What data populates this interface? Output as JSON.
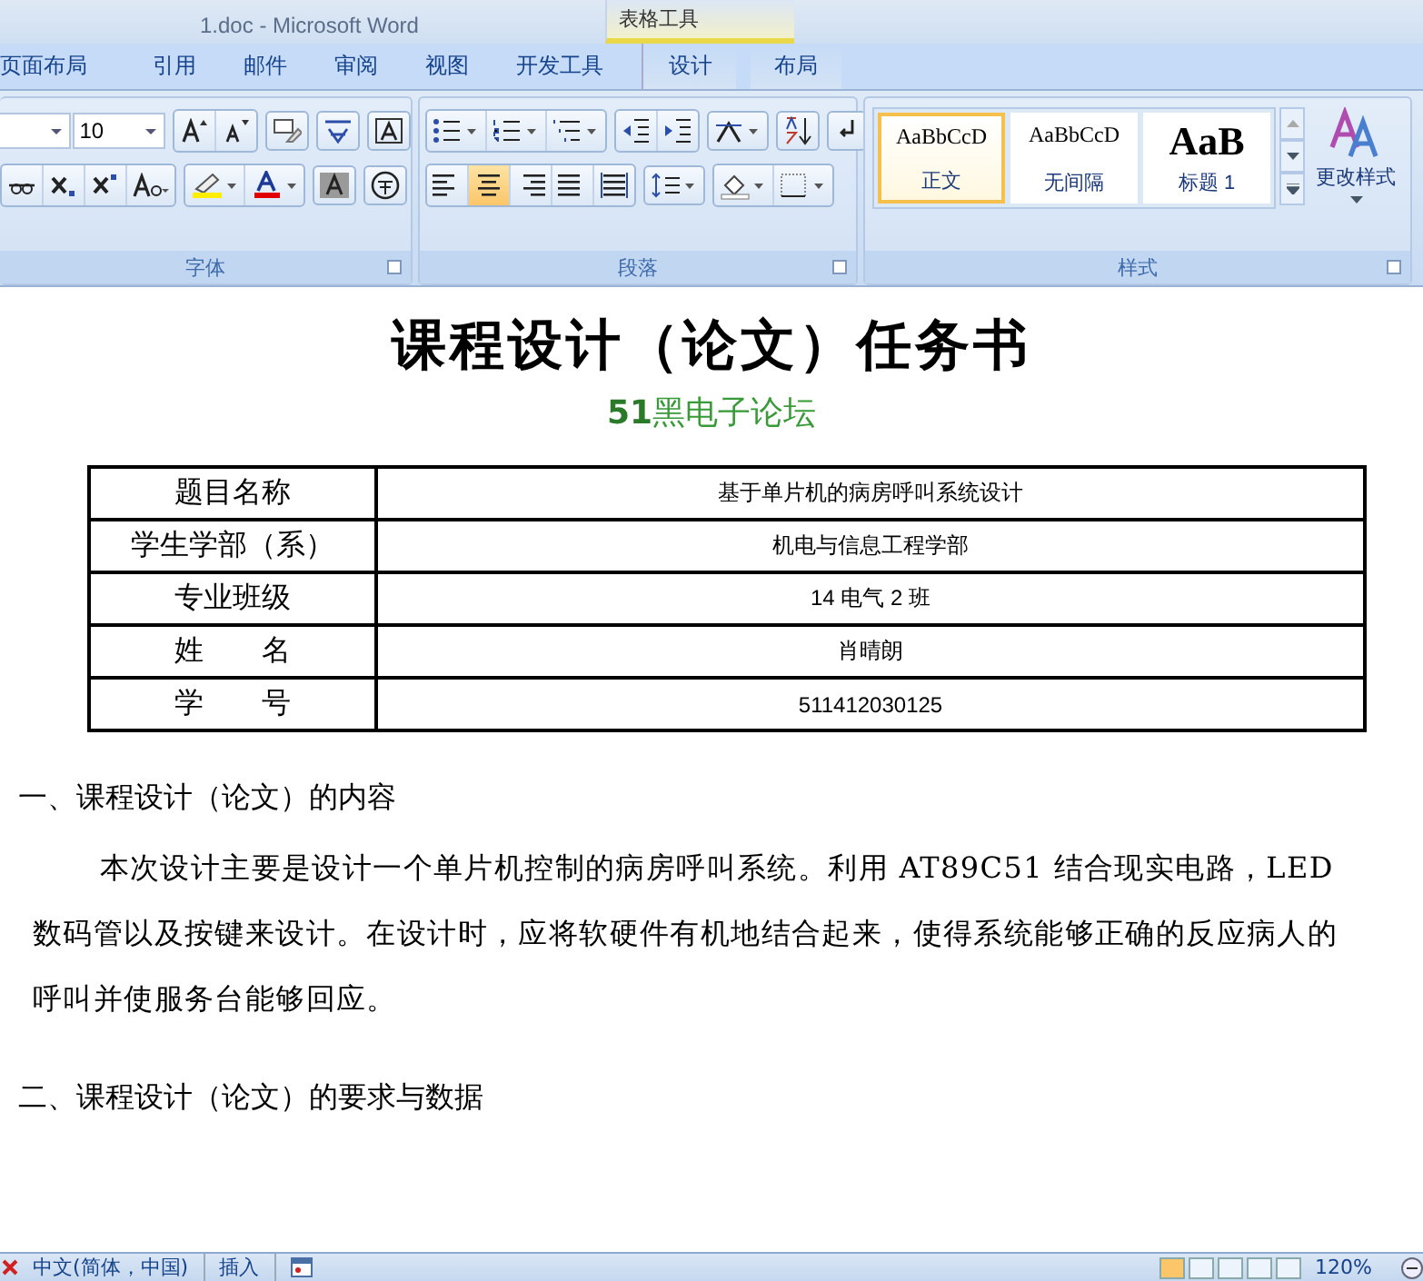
{
  "window": {
    "title": "1.doc - Microsoft Word",
    "context_tab_group": "表格工具"
  },
  "ribbon_tabs": [
    {
      "label": "页面布局",
      "selected": false,
      "contextual": false
    },
    {
      "label": "引用",
      "selected": false,
      "contextual": false
    },
    {
      "label": "邮件",
      "selected": false,
      "contextual": false
    },
    {
      "label": "审阅",
      "selected": false,
      "contextual": false
    },
    {
      "label": "视图",
      "selected": false,
      "contextual": false
    },
    {
      "label": "开发工具",
      "selected": false,
      "contextual": false
    },
    {
      "label": "设计",
      "selected": false,
      "contextual": true
    },
    {
      "label": "布局",
      "selected": false,
      "contextual": true
    }
  ],
  "font_group": {
    "label": "字体",
    "font_size": "10"
  },
  "paragraph_group": {
    "label": "段落",
    "alignments": [
      {
        "kind": "left",
        "selected": false
      },
      {
        "kind": "center",
        "selected": true
      },
      {
        "kind": "right",
        "selected": false
      },
      {
        "kind": "justify",
        "selected": false
      },
      {
        "kind": "distributed",
        "selected": false
      }
    ]
  },
  "styles_group": {
    "label": "样式",
    "styles": [
      {
        "preview": "AaBbCcD",
        "name": "正文",
        "kind": "normal",
        "selected": true
      },
      {
        "preview": "AaBbCcD",
        "name": "无间隔",
        "kind": "normal",
        "selected": false
      },
      {
        "preview": "AaB",
        "name": "标题 1",
        "kind": "heading",
        "selected": false
      }
    ],
    "change_styles": "更改样式"
  },
  "document": {
    "title": "课程设计（论文）任务书",
    "subtitle": "**51**黑电子论坛",
    "info_table": [
      {
        "label": "题目名称",
        "value": "基于单片机的病房呼叫系统设计"
      },
      {
        "label": "学生学部（系）",
        "value": "机电与信息工程学部"
      },
      {
        "label": "专业班级",
        "value": "14 电气 2 班"
      },
      {
        "label": "姓　　名",
        "value": "肖晴朗"
      },
      {
        "label": "学　　号",
        "value": "511412030125"
      }
    ],
    "sections": [
      {
        "heading": "一、课程设计（论文）的内容",
        "paragraph": "本次设计主要是设计一个单片机控制的病房呼叫系统。利用 AT89C51 结合现实电路，LED 数码管以及按键来设计。在设计时，应将软硬件有机地结合起来，使得系统能够正确的反应病人的呼叫并使服务台能够回应。"
      },
      {
        "heading": "二、课程设计（论文）的要求与数据"
      }
    ]
  },
  "status_bar": {
    "language": "中文(简体，中国)",
    "mode": "插入",
    "zoom": "120%"
  }
}
